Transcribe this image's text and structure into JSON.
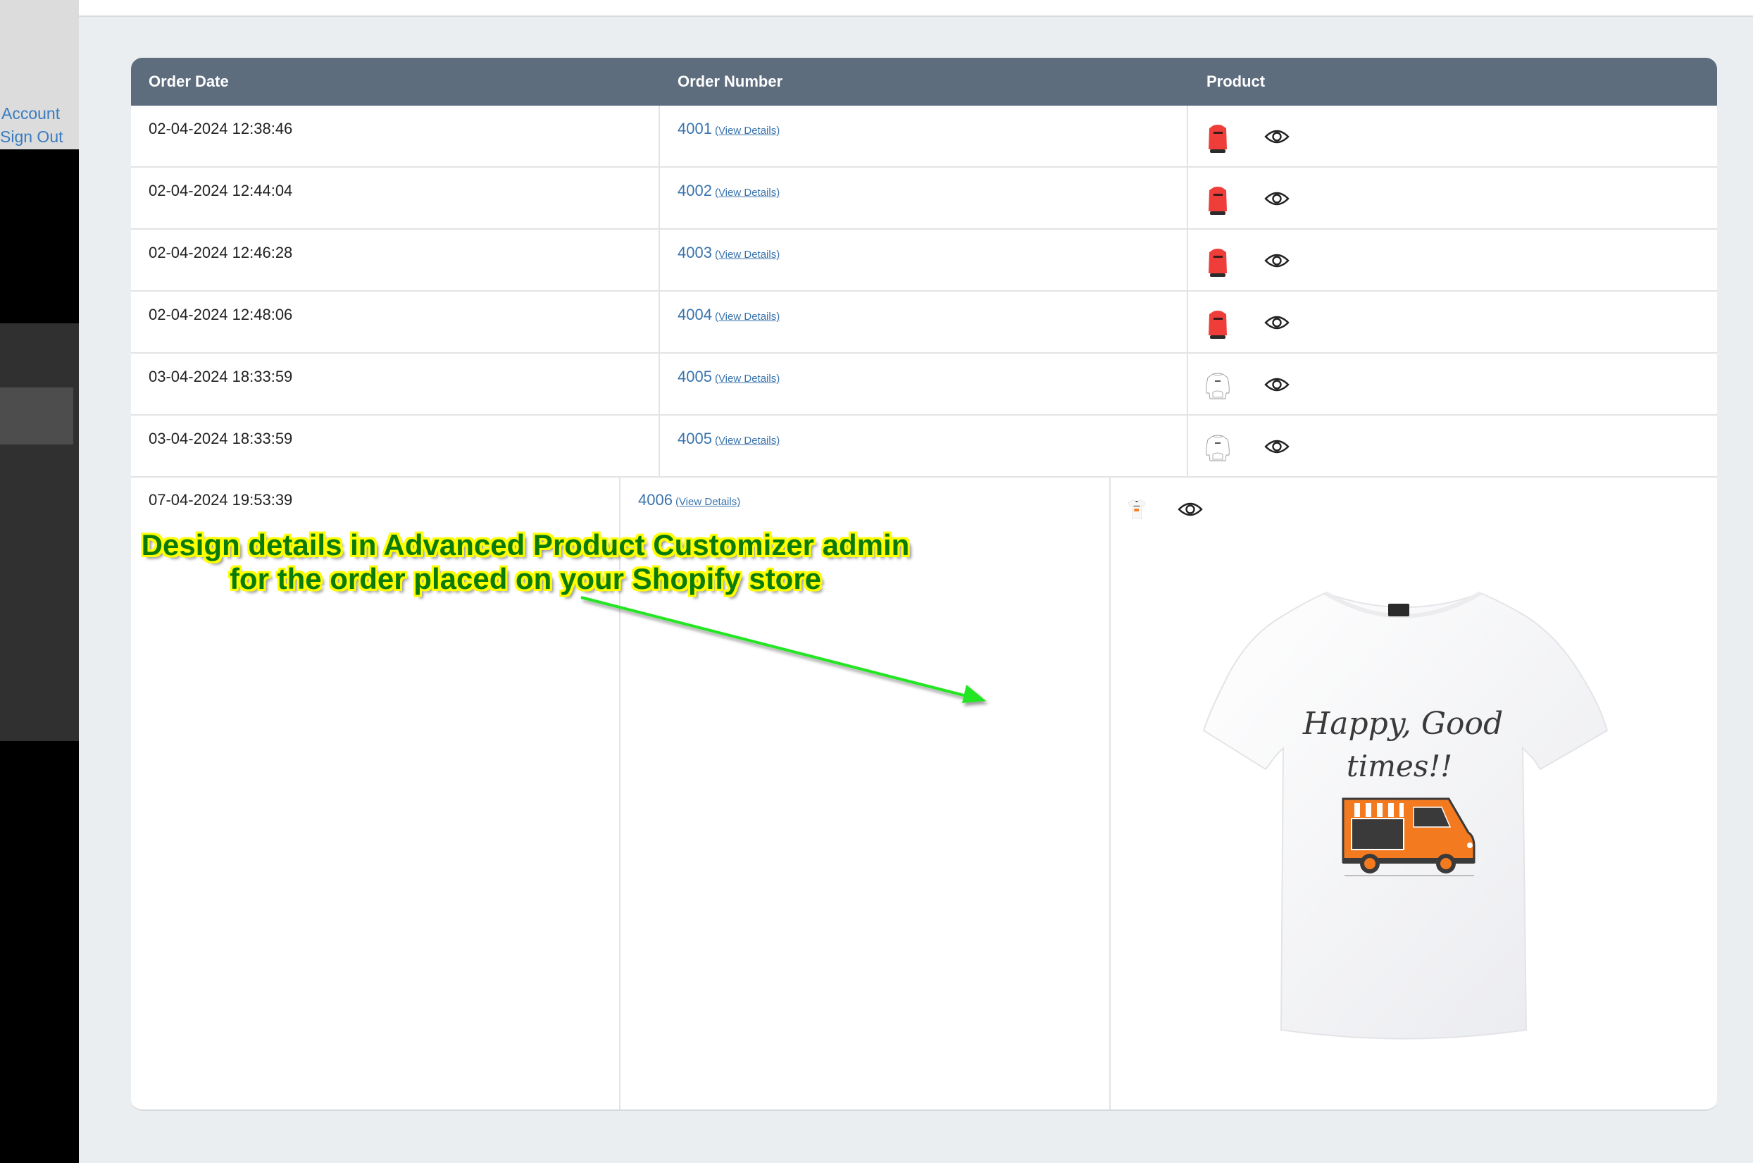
{
  "sidebar": {
    "links": [
      {
        "label": "Account"
      },
      {
        "label": "Sign Out"
      }
    ]
  },
  "table": {
    "headers": {
      "order_date": "Order Date",
      "order_number": "Order Number",
      "product": "Product"
    },
    "view_details_label": "(View Details)",
    "rows": [
      {
        "date": "02-04-2024 12:38:46",
        "number": "4001",
        "product_thumb": "red-tshirt",
        "action_icon": "eye-icon"
      },
      {
        "date": "02-04-2024 12:44:04",
        "number": "4002",
        "product_thumb": "red-tshirt",
        "action_icon": "eye-icon"
      },
      {
        "date": "02-04-2024 12:46:28",
        "number": "4003",
        "product_thumb": "red-tshirt",
        "action_icon": "eye-icon"
      },
      {
        "date": "02-04-2024 12:48:06",
        "number": "4004",
        "product_thumb": "red-tshirt",
        "action_icon": "eye-icon"
      },
      {
        "date": "03-04-2024 18:33:59",
        "number": "4005",
        "product_thumb": "white-sweatshirt-outline",
        "action_icon": "eye-icon"
      },
      {
        "date": "03-04-2024 18:33:59",
        "number": "4005",
        "product_thumb": "white-sweatshirt-outline",
        "action_icon": "eye-icon"
      },
      {
        "date": "07-04-2024 19:53:39",
        "number": "4006",
        "product_thumb": "white-tshirt-food-truck",
        "action_icon": "eye-icon"
      }
    ]
  },
  "preview": {
    "design_text_line1": "Happy, Good",
    "design_text_line2": "times!!",
    "design_graphic": "orange food truck"
  },
  "annotation": {
    "line1": "Design details in Advanced Product Customizer admin",
    "line2": "for the order placed on your Shopify store"
  },
  "colors": {
    "header_bg": "#5d6d7e",
    "link": "#3a74ad",
    "annotation_text": "#0a7a0a",
    "annotation_outline": "#ffff00",
    "arrow": "#22e622",
    "truck_orange": "#f47a20"
  }
}
